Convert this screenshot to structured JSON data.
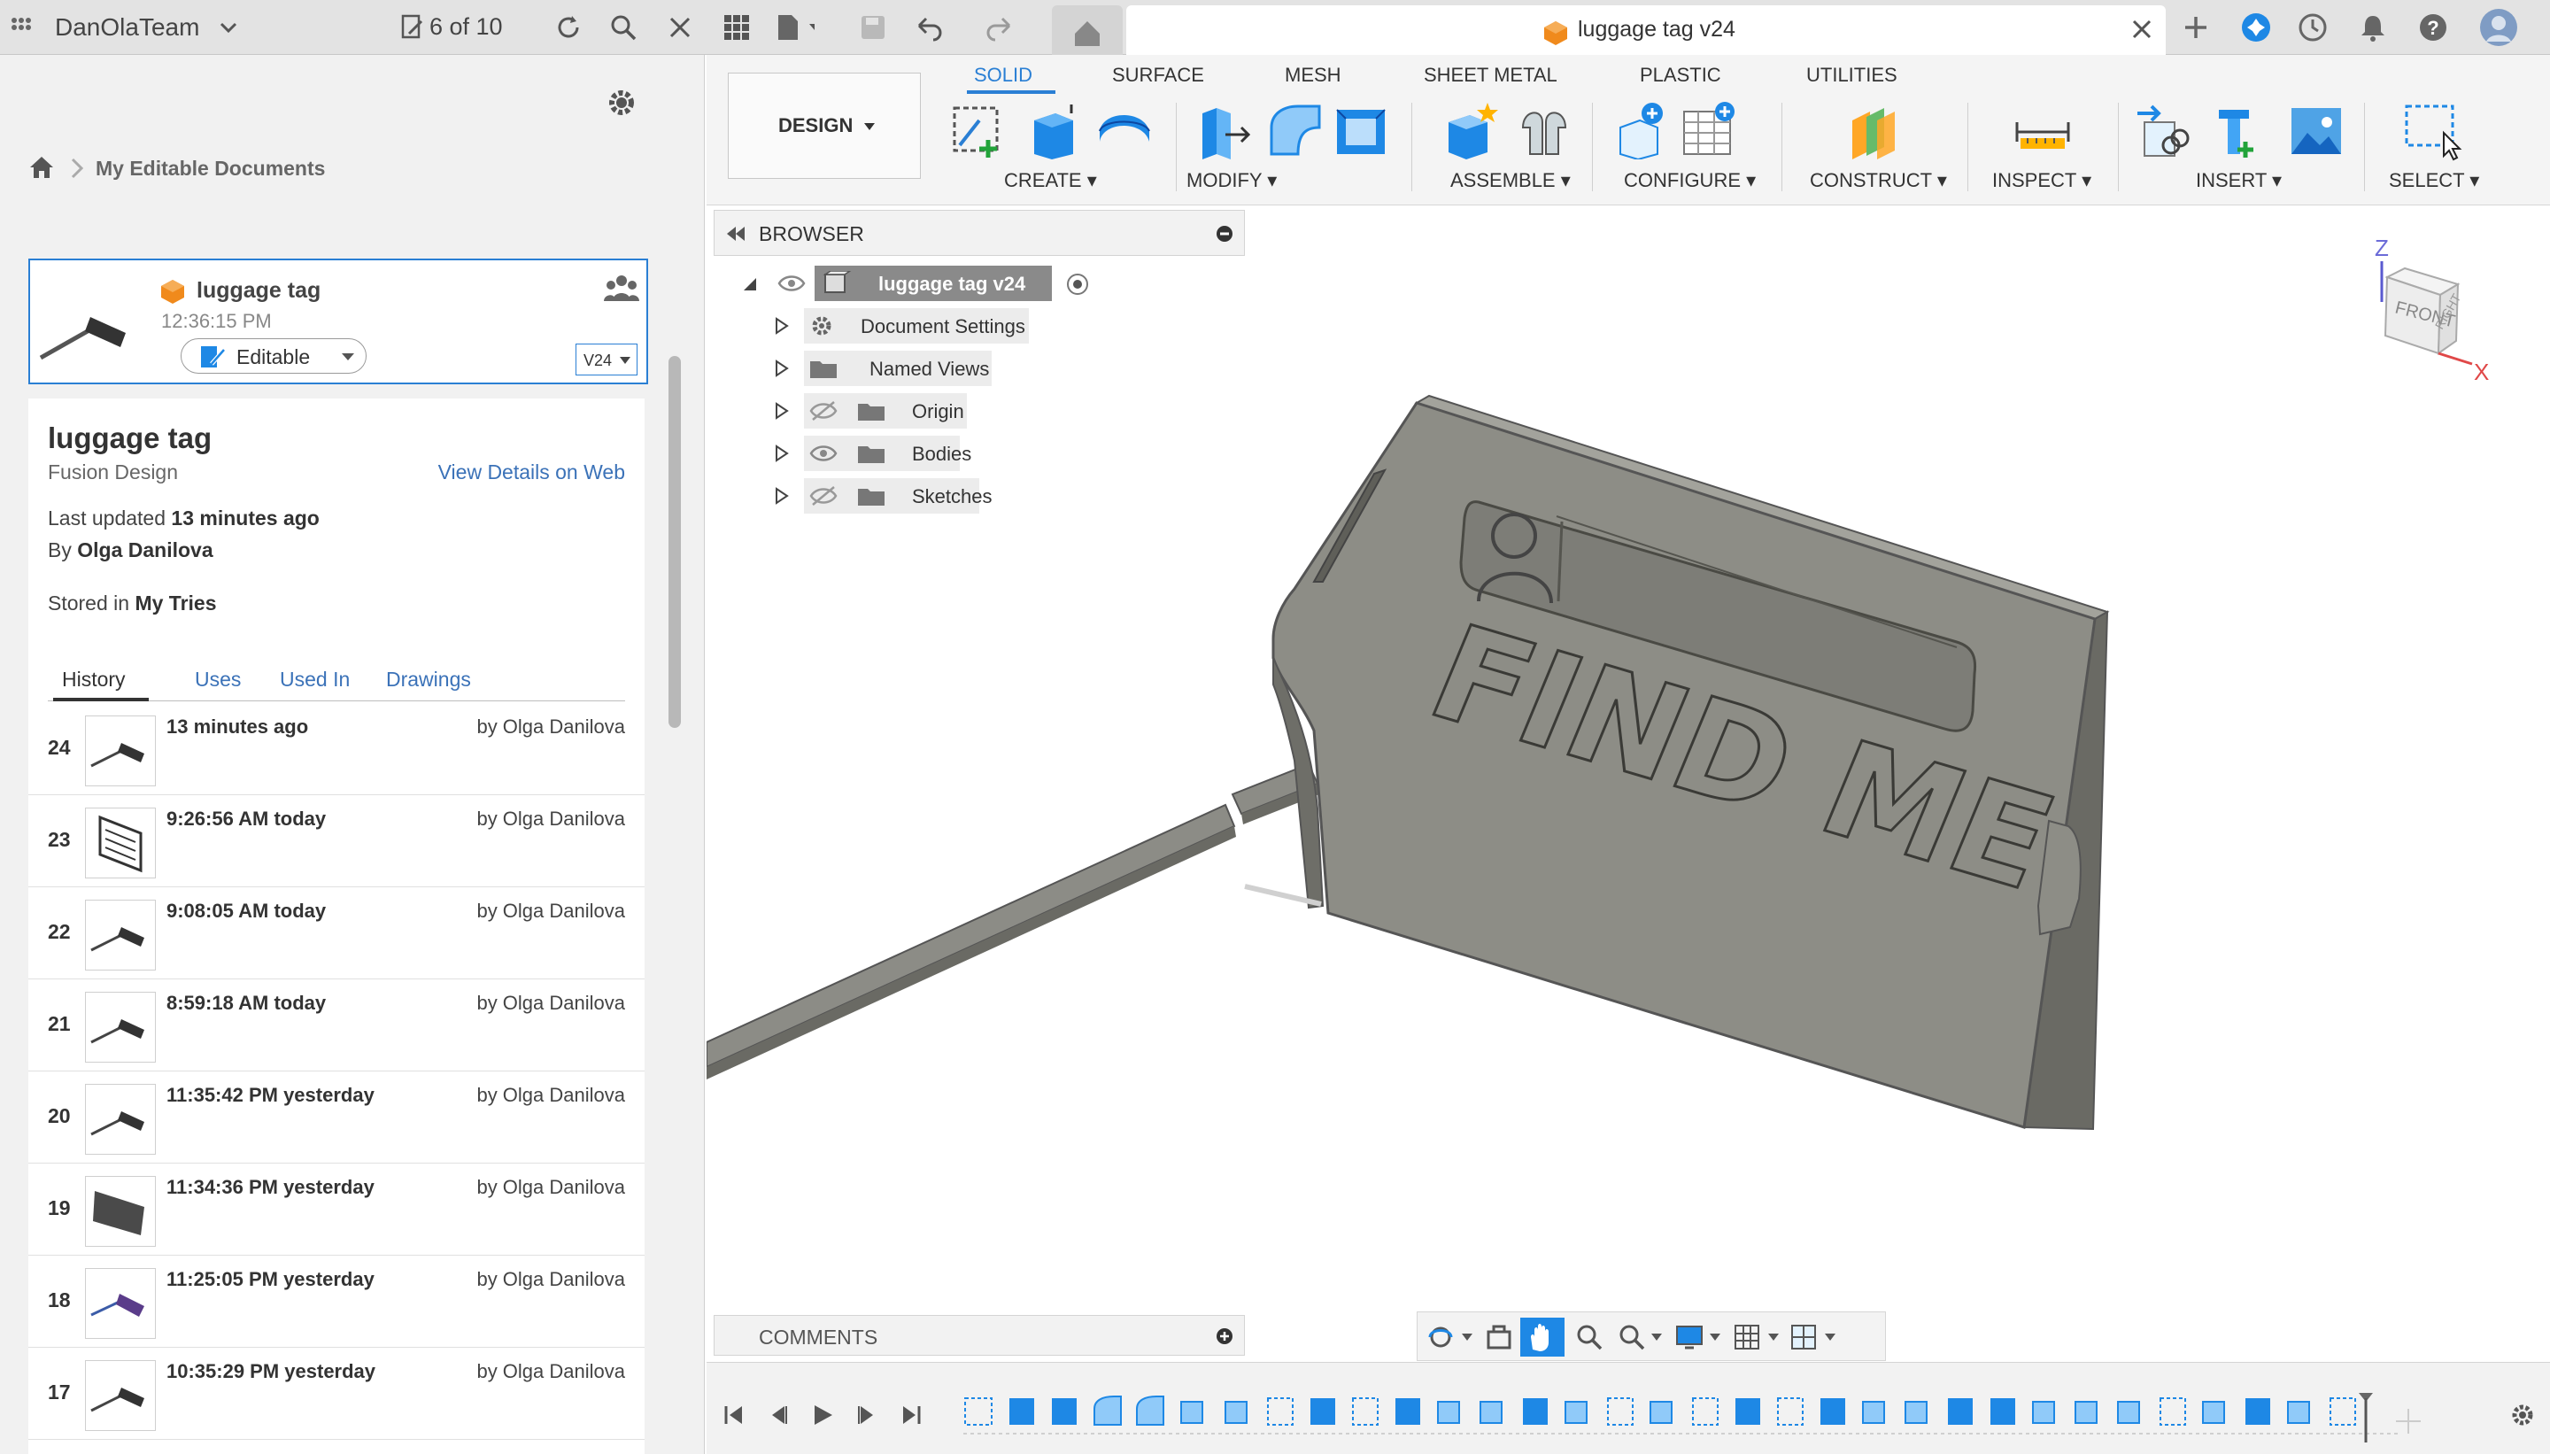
{
  "topbar": {
    "team_name": "DanOlaTeam",
    "version_count": "6 of 10",
    "doc_tab_title": "luggage tag v24"
  },
  "leftpanel": {
    "breadcrumb": "My Editable Documents",
    "card": {
      "title": "luggage tag",
      "time": "12:36:15 PM",
      "editable_label": "Editable",
      "version": "V24"
    },
    "detail": {
      "title": "luggage tag",
      "type": "Fusion Design",
      "view_web": "View Details on Web",
      "updated_prefix": "Last updated",
      "updated_value": "13 minutes ago",
      "by_prefix": "By",
      "by_value": "Olga Danilova",
      "stored_prefix": "Stored in",
      "stored_value": "My Tries"
    },
    "tabs": [
      "History",
      "Uses",
      "Used In",
      "Drawings"
    ],
    "history": [
      {
        "num": "24",
        "time": "13 minutes ago",
        "by": "by Olga Danilova"
      },
      {
        "num": "23",
        "time": "9:26:56 AM today",
        "by": "by Olga Danilova"
      },
      {
        "num": "22",
        "time": "9:08:05 AM today",
        "by": "by Olga Danilova"
      },
      {
        "num": "21",
        "time": "8:59:18 AM today",
        "by": "by Olga Danilova"
      },
      {
        "num": "20",
        "time": "11:35:42 PM yesterday",
        "by": "by Olga Danilova"
      },
      {
        "num": "19",
        "time": "11:34:36 PM yesterday",
        "by": "by Olga Danilova"
      },
      {
        "num": "18",
        "time": "11:25:05 PM yesterday",
        "by": "by Olga Danilova"
      },
      {
        "num": "17",
        "time": "10:35:29 PM yesterday",
        "by": "by Olga Danilova"
      }
    ]
  },
  "toolbar": {
    "workspace": "DESIGN",
    "tabs": [
      "SOLID",
      "SURFACE",
      "MESH",
      "SHEET METAL",
      "PLASTIC",
      "UTILITIES"
    ],
    "groups": [
      "CREATE",
      "MODIFY",
      "ASSEMBLE",
      "CONFIGURE",
      "CONSTRUCT",
      "INSPECT",
      "INSERT",
      "SELECT"
    ]
  },
  "browser": {
    "title": "BROWSER",
    "root": "luggage tag v24",
    "nodes": [
      "Document Settings",
      "Named Views",
      "Origin",
      "Bodies",
      "Sketches"
    ]
  },
  "viewport": {
    "model_text": "FIND ME",
    "viewcube_face": "FRONT",
    "viewcube_side": "RIGHT",
    "axis_z": "Z",
    "axis_x": "X"
  },
  "comments": {
    "label": "COMMENTS"
  },
  "colors": {
    "accent": "#2a7fd4",
    "model": "#8d8d86",
    "model_dark": "#6c6c66"
  }
}
